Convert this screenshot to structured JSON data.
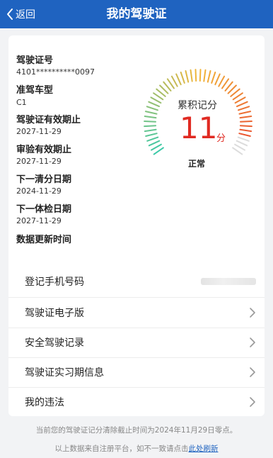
{
  "header": {
    "back_label": "返回",
    "title": "我的驾驶证"
  },
  "license": {
    "number_label": "驾驶证号",
    "number_value": "4101**********0097",
    "class_label": "准驾车型",
    "class_value": "C1",
    "expiry_label": "驾驶证有效期止",
    "expiry_value": "2027-11-29",
    "inspection_label": "审验有效期止",
    "inspection_value": "2027-11-29",
    "clear_date_label": "下一清分日期",
    "clear_date_value": "2024-11-29",
    "physical_label": "下一体检日期",
    "physical_value": "2027-11-29",
    "update_label": "数据更新时间"
  },
  "gauge": {
    "title": "累积记分",
    "value": "11",
    "unit": "分",
    "status": "正常",
    "points": 11,
    "max_points": 12,
    "colors": {
      "low": "#3cc9a8",
      "mid": "#f2b63a",
      "high": "#e8432e",
      "empty": "#dcdcdc"
    }
  },
  "menu": {
    "phone_label": "登记手机号码",
    "e_license_label": "驾驶证电子版",
    "safe_record_label": "安全驾驶记录",
    "probation_label": "驾驶证实习期信息",
    "violations_label": "我的违法"
  },
  "footer": {
    "notice": "当前您的驾驶证记分清除截止时间为2024年11月29日零点。",
    "source_prefix": "以上数据来自注册平台，如不一致请点击",
    "refresh_link": "此处刷新"
  }
}
